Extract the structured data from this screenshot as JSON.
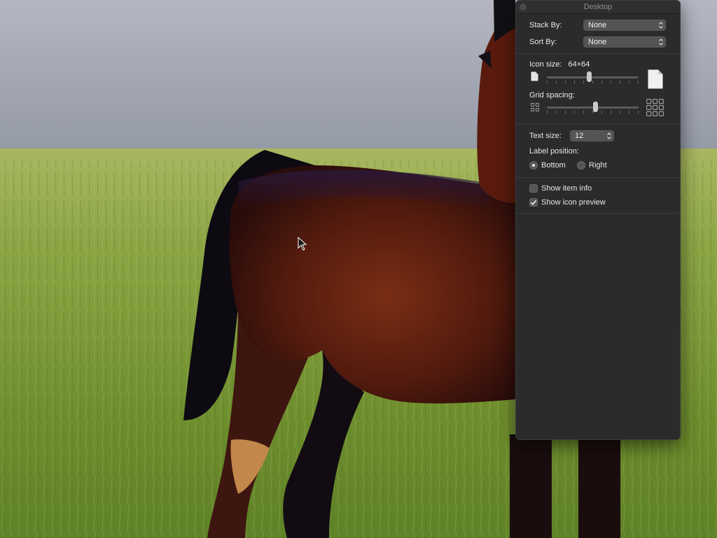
{
  "window": {
    "title": "Desktop"
  },
  "stack_by": {
    "label": "Stack By:",
    "value": "None"
  },
  "sort_by": {
    "label": "Sort By:",
    "value": "None"
  },
  "icon_size": {
    "label": "Icon size:",
    "value": "64×64",
    "level": 0.46
  },
  "grid_spacing": {
    "label": "Grid spacing:",
    "level": 0.53
  },
  "text_size": {
    "label": "Text size:",
    "value": "12"
  },
  "label_position": {
    "label": "Label position:",
    "options": [
      "Bottom",
      "Right"
    ],
    "selected": "Bottom"
  },
  "show_item_info": {
    "label": "Show item info",
    "checked": false
  },
  "show_icon_preview": {
    "label": "Show icon preview",
    "checked": true
  },
  "colors": {
    "panel_bg": "#2b2b2c",
    "sky": "#9ea0ab",
    "grass": "#7f9a35",
    "horse": "#5a1e10"
  },
  "icons": [
    "close-button",
    "small-document-icon",
    "large-document-icon",
    "small-grid-icon",
    "large-grid-icon",
    "popup-arrows-icon",
    "checkmark-icon",
    "mouse-pointer-icon"
  ]
}
